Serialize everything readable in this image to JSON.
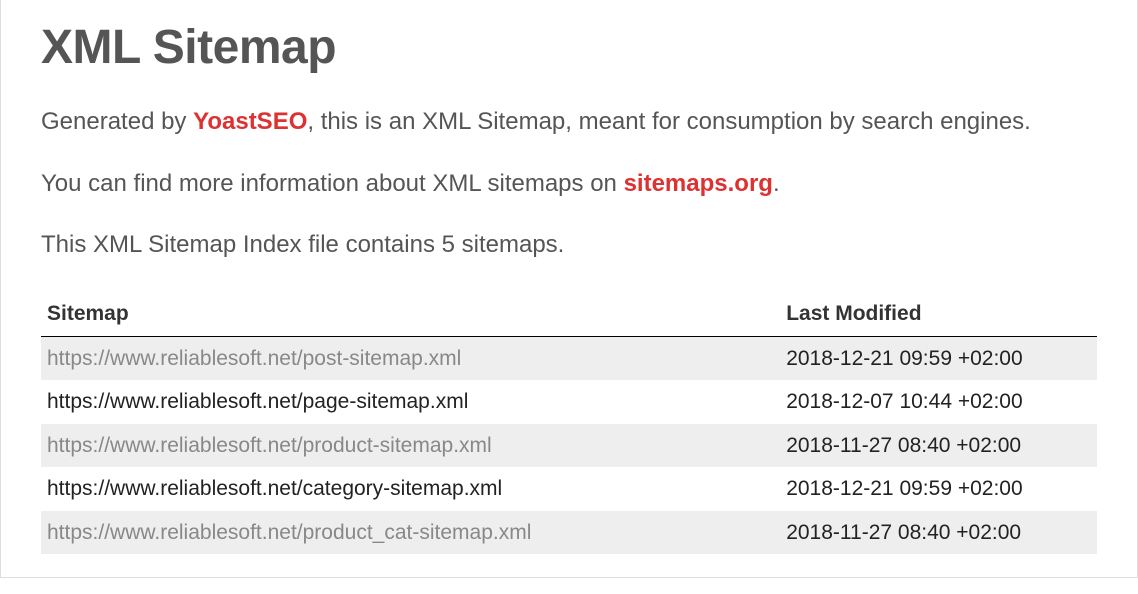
{
  "header": {
    "title": "XML Sitemap"
  },
  "intro": {
    "line1_prefix": "Generated by ",
    "line1_link": "YoastSEO",
    "line1_suffix": ", this is an XML Sitemap, meant for consumption by search engines.",
    "line2_prefix": "You can find more information about XML sitemaps on ",
    "line2_link": "sitemaps.org",
    "line2_suffix": ".",
    "line3": "This XML Sitemap Index file contains 5 sitemaps."
  },
  "table": {
    "columns": {
      "sitemap": "Sitemap",
      "last_modified": "Last Modified"
    },
    "rows": [
      {
        "url": "https://www.reliablesoft.net/post-sitemap.xml",
        "modified": "2018-12-21 09:59 +02:00"
      },
      {
        "url": "https://www.reliablesoft.net/page-sitemap.xml",
        "modified": "2018-12-07 10:44 +02:00"
      },
      {
        "url": "https://www.reliablesoft.net/product-sitemap.xml",
        "modified": "2018-11-27 08:40 +02:00"
      },
      {
        "url": "https://www.reliablesoft.net/category-sitemap.xml",
        "modified": "2018-12-21 09:59 +02:00"
      },
      {
        "url": "https://www.reliablesoft.net/product_cat-sitemap.xml",
        "modified": "2018-11-27 08:40 +02:00"
      }
    ]
  }
}
